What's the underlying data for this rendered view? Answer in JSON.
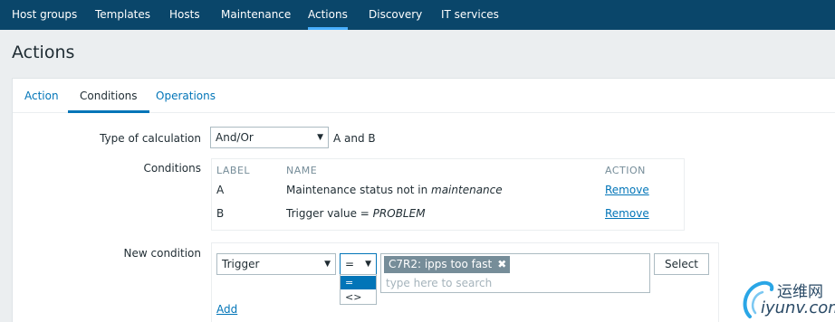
{
  "nav": {
    "items": [
      "Host groups",
      "Templates",
      "Hosts",
      "Maintenance",
      "Actions",
      "Discovery",
      "IT services"
    ],
    "active": "Actions"
  },
  "page": {
    "title": "Actions"
  },
  "tabs": [
    {
      "label": "Action",
      "active": false
    },
    {
      "label": "Conditions",
      "active": true
    },
    {
      "label": "Operations",
      "active": false
    }
  ],
  "form": {
    "type_of_calculation_label": "Type of calculation",
    "type_of_calculation_value": "And/Or",
    "calculation_expression": "A and B",
    "conditions_label": "Conditions",
    "conditions_table": {
      "headers": [
        "LABEL",
        "NAME",
        "ACTION"
      ],
      "rows": [
        {
          "label": "A",
          "name_prefix": "Maintenance status not in ",
          "name_value": "maintenance",
          "action": "Remove"
        },
        {
          "label": "B",
          "name_prefix": "Trigger value = ",
          "name_value": "PROBLEM",
          "action": "Remove"
        }
      ]
    },
    "new_condition_label": "New condition",
    "new_condition": {
      "type_value": "Trigger",
      "operator_value": "=",
      "operator_options": [
        "=",
        "<>"
      ],
      "operator_selected_index": 0,
      "selected_tag": "C7R2: ipps too fast",
      "search_placeholder": "type here to search",
      "select_button": "Select",
      "add_link": "Add"
    }
  },
  "watermark": {
    "cn": "运维网",
    "en": "iyunv.com"
  },
  "colors": {
    "nav_bg": "#0a466a",
    "nav_active_underline": "#49b0ff",
    "link": "#0275b8",
    "tag_bg": "#768d99",
    "page_bg": "#ebeef0"
  }
}
